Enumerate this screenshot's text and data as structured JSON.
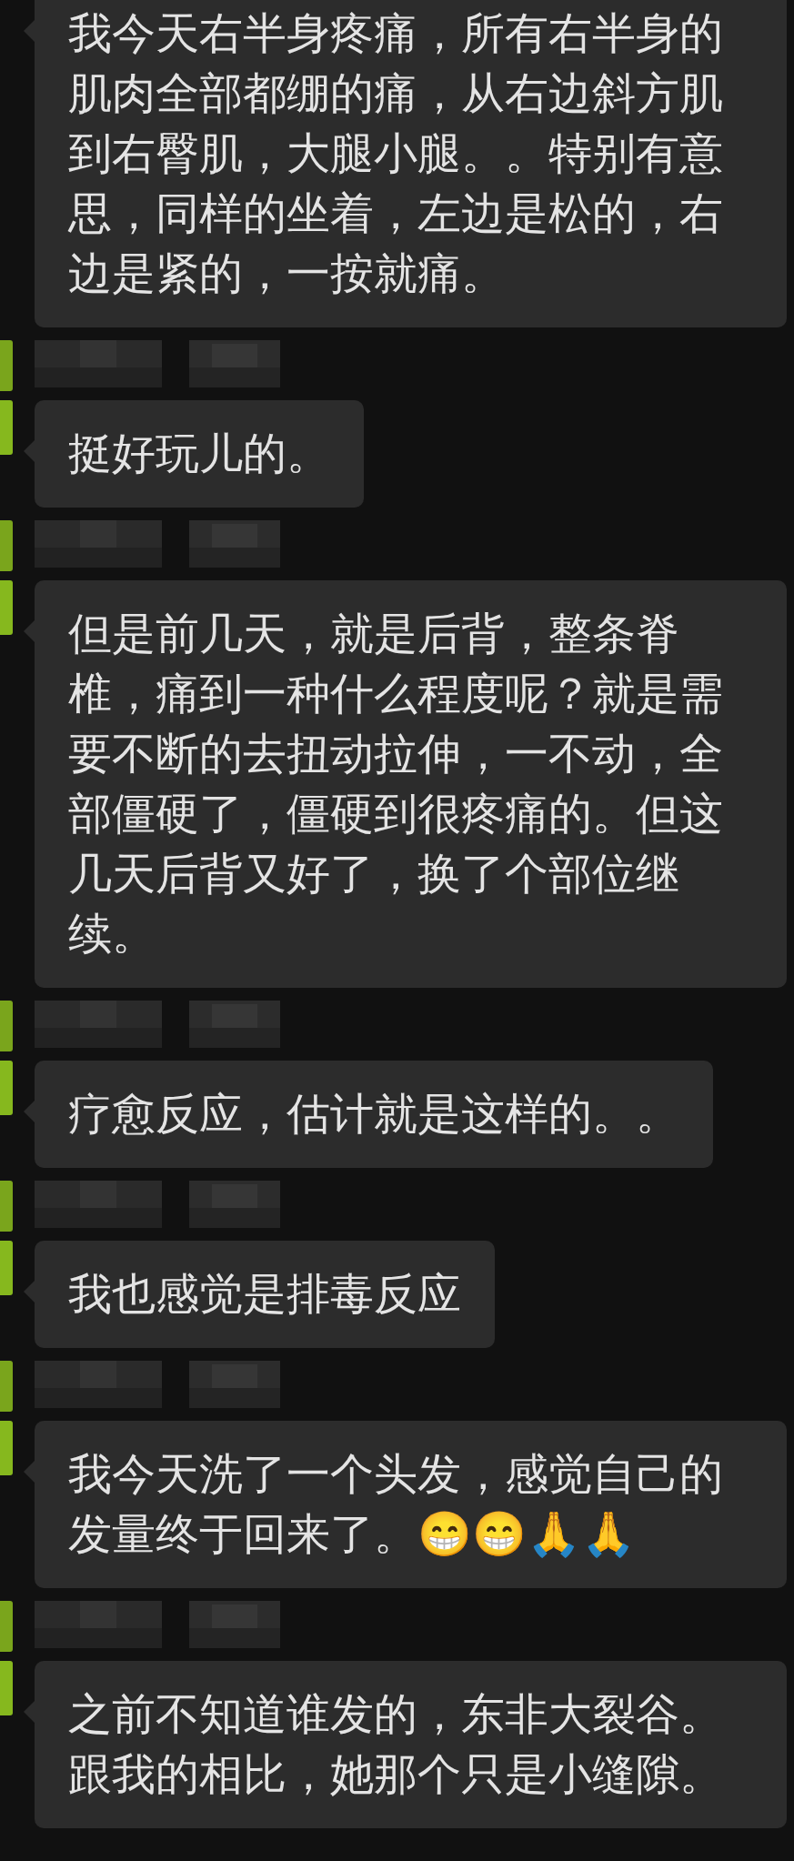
{
  "messages": [
    {
      "text": "我今天右半身疼痛，所有右半身的肌肉全部都绷的痛，从右边斜方肌到右臀肌，大腿小腿。。特别有意思，同样的坐着，左边是松的，右边是紧的，一按就痛。"
    },
    {
      "text": "挺好玩儿的。"
    },
    {
      "text": "但是前几天，就是后背，整条脊椎，痛到一种什么程度呢？就是需要不断的去扭动拉伸，一不动，全部僵硬了，僵硬到很疼痛的。但这几天后背又好了，换了个部位继续。"
    },
    {
      "text": "疗愈反应，估计就是这样的。。"
    },
    {
      "text": "我也感觉是排毒反应"
    },
    {
      "text": "我今天洗了一个头发，感觉自己的发量终于回来了。😁😁🙏🙏"
    },
    {
      "text": "之前不知道谁发的，东非大裂谷。跟我的相比，她那个只是小缝隙。"
    }
  ]
}
